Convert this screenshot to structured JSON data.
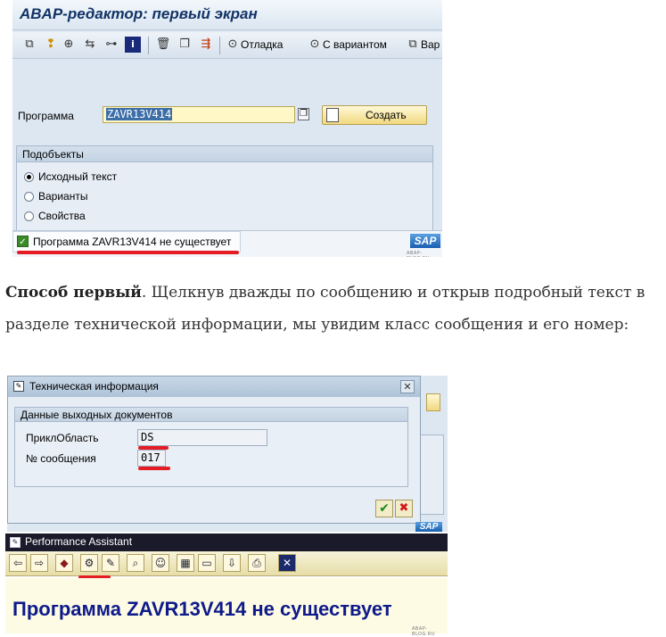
{
  "editor": {
    "title": "ABAP-редактор: первый экран",
    "toolbar": {
      "debug_label": "Отладка",
      "variant_label": "С вариантом",
      "cut_label": "Вар"
    },
    "program_label": "Программа",
    "program_value": "ZAVR13V414",
    "create_label": "Создать",
    "subobjects_title": "Подобъекты",
    "subobjects": [
      {
        "label": "Исходный текст",
        "selected": true
      },
      {
        "label": "Варианты",
        "selected": false
      },
      {
        "label": "Свойства",
        "selected": false
      }
    ],
    "status_message": "Программа ZAVR13V414 не существует"
  },
  "article": {
    "bold": "Способ первый",
    "text": ". Щелкнув дважды по сообщению и открыв подробный текст в разделе технической информации, мы увидим класс сообщения и его номер:"
  },
  "tech_dialog": {
    "title": "Техническая информация",
    "group_title": "Данные выходных документов",
    "app_area_label": "ПриклОбласть",
    "app_area_value": "DS",
    "msg_no_label": "№ сообщения",
    "msg_no_value": "017"
  },
  "assistant": {
    "title": "Performance Assistant",
    "message": "Программа ZAVR13V414 не существует"
  },
  "brand": {
    "logo_text": "SAP",
    "watermark": "ABAP-BLOG.RU"
  },
  "colors": {
    "accent_red": "#e51c24",
    "sap_blue": "#1a5fb0",
    "message_blue": "#0e1a8a"
  }
}
